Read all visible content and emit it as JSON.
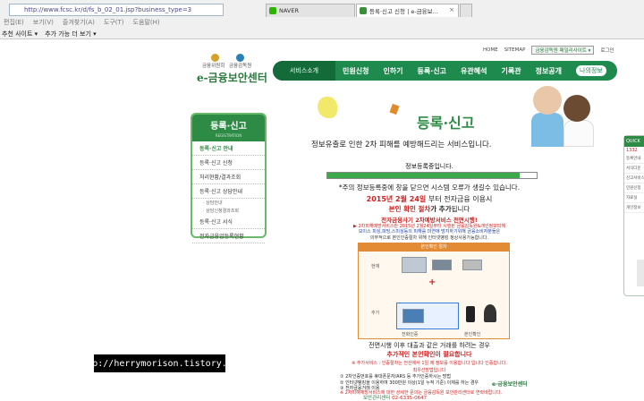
{
  "browser": {
    "address": "http://www.fcsc.kr/d/fs_b_02_01.jsp?business_type=3",
    "tabs": [
      {
        "label": "NAVER"
      },
      {
        "label": "등록·신고 신청 | e-금융보..."
      }
    ],
    "menu": [
      "편집(E)",
      "보기(V)",
      "즐겨찾기(A)",
      "도구(T)",
      "도움말(H)"
    ],
    "favorites": [
      {
        "label": "추천 사이트 ▾"
      },
      {
        "label": "추가 가능 더 보기 ▾"
      }
    ]
  },
  "site": {
    "logo": {
      "org1": "금융위원회",
      "org2": "금융감독원",
      "name": "e-금융보안센터"
    },
    "util": {
      "home": "HOME",
      "sitemap": "SITEMAP",
      "family": "금융감독원 패밀리사이트 ▾",
      "login": "로그인"
    },
    "nav": {
      "service": "서비스소개",
      "items": [
        "민원신청",
        "인하기",
        "등록·신고",
        "유관혜석",
        "기록관",
        "정보공개"
      ],
      "mypage": "나의정보"
    },
    "side": {
      "title": "등록·신고",
      "title_en": "REGISTRATION",
      "items": [
        {
          "label": "등록·신고 안내",
          "active": true
        },
        {
          "label": "등록·신고 신청"
        },
        {
          "label": "처리현황/결과조회"
        },
        {
          "label": "등록·신고 상담안내"
        }
      ],
      "sub_items": [
        "· 상담안내",
        "· 상담신청결과조회"
      ],
      "items2": [
        {
          "label": "등록·신고 서식"
        },
        {
          "label": "전자금융업등록현황"
        }
      ]
    },
    "page": {
      "title": "등록·신고",
      "subtitle": "정보유출로 인한 2차 피해를 예방해드리는 서비스입니다.",
      "progress_label": "정보등록중입니다.",
      "progress": 0.92,
      "warning": "*주의 정보등록중에 창을 닫으면 시스템 오류가 생길수 있습니다.",
      "date_line_a": "2015년 2월 24일",
      "date_line_b": "부터 전자금융 이용시",
      "auth_line_a": "본인 확인 절차",
      "auth_line_b": "가 추가",
      "auth_line_c": "됩니다",
      "system_line": "전자금융사기 2차예방서비스 전면시행!",
      "notice_lines": [
        "▶ 2차피해예방서비스란 2015년 2월24일부터 시행된 금융감독원&개인정보피해",
        "보이스 피싱,파밍,스미싱등의 피해를 미연에 방지하기위해 금융소비자분들은",
        "의무적으로 본인인증절차 위해 인터넷뱅킹 정상사용가능합니다."
      ],
      "diagram": {
        "header": "본인확인 절차",
        "label_current": "현재",
        "label_added": "추가",
        "caption1": "전화인증",
        "caption2": "본인확인"
      },
      "after_line": "전면시행 이후 대출과 같은 거래를 하려는 경우",
      "after_line2": "추가적인 본인확인이 필요합니다",
      "after_line3": "※ 추가서비스 : 인증절차는 전산에서 1일 제 정보를 이용합니다 입니다 인증합니다.",
      "after_line4": "최우선방법입니다",
      "bullets": [
        "① 2차인증번호를 휴대폰문자/ARS 등 추가인증하시는 방법",
        "② 인터넷뱅킹을 이용하여 300만원 이상(1일 누적 기준) 이체를 하는 경우",
        "③ 전자금융거래 이용"
      ],
      "bullet_note": "※ 2차피해예방서비스에 대한 상세한 문의는 금융감독원 보안관리센터로 연락바랍니다.",
      "contact_label": "보안관리센터",
      "contact_phone": "02-6335-0647",
      "footer_logo": "e-금융보안센터"
    },
    "quick": {
      "title": "QUICK",
      "phone": "1332",
      "items": [
        "등록안내",
        "서식다운",
        "신고서비스",
        "민원신청",
        "자료실",
        "개인정보"
      ]
    }
  },
  "watermark": "http://herrymorison.tistory.com"
}
